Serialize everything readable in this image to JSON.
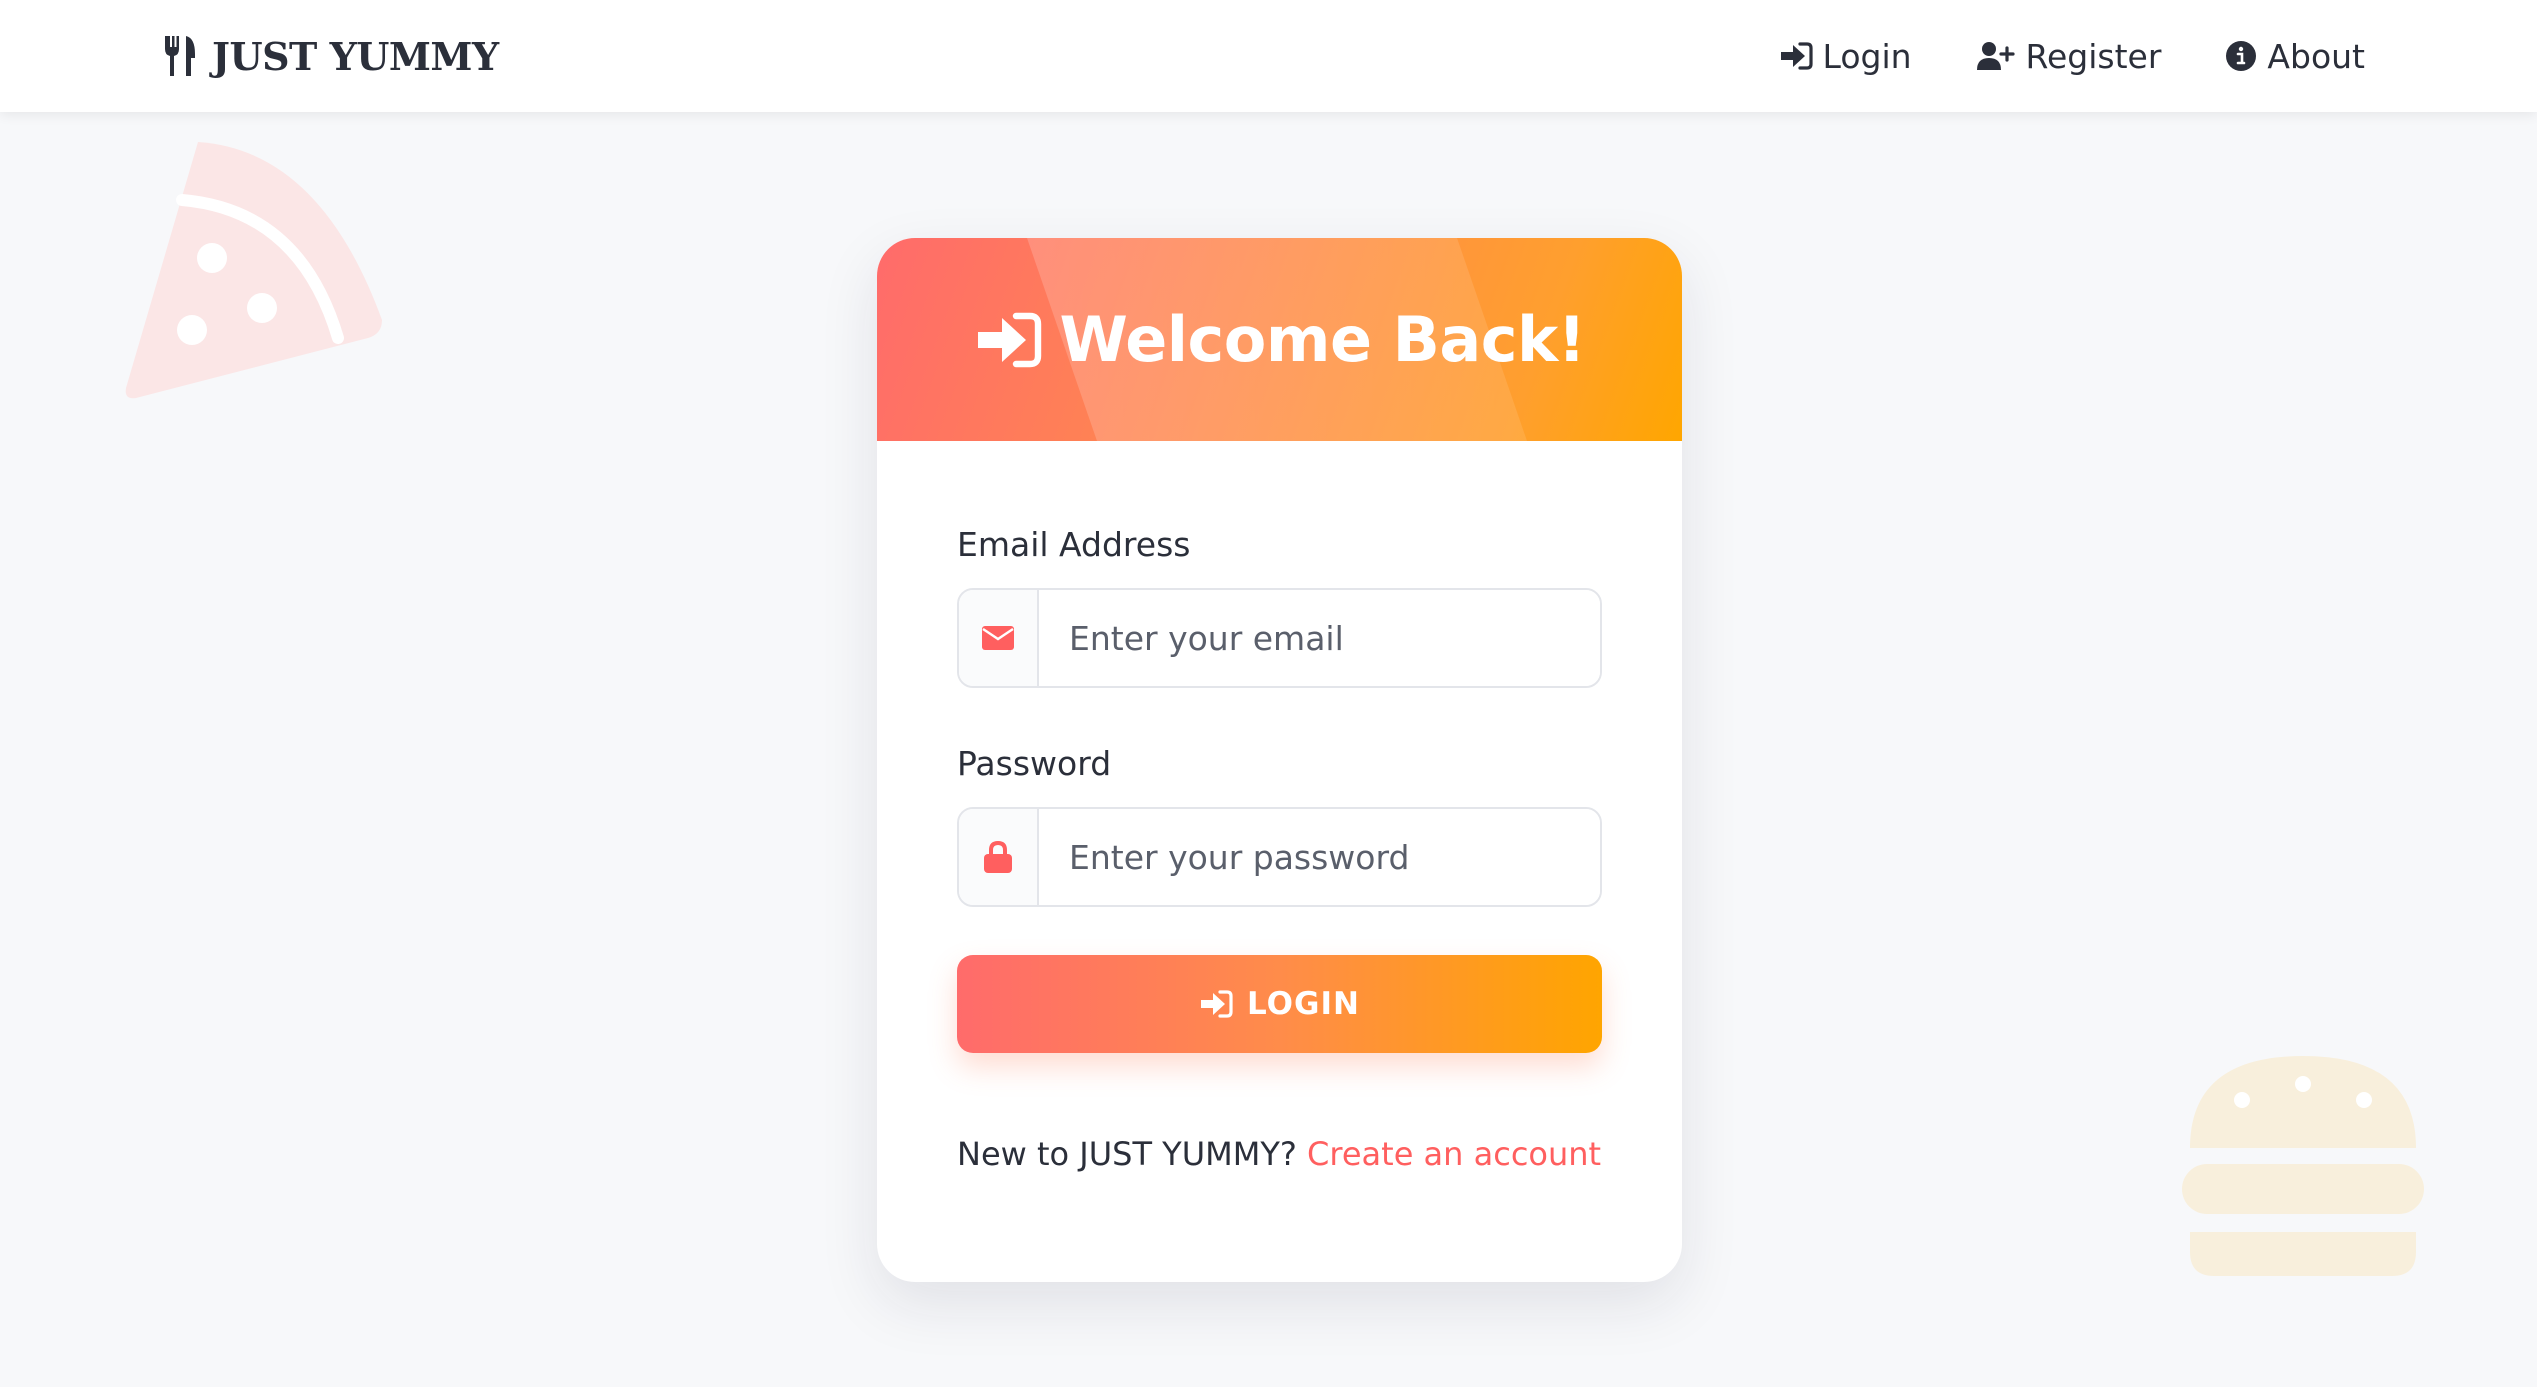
{
  "navbar": {
    "brand": "JUST YUMMY",
    "links": [
      {
        "label": "Login",
        "icon": "sign-in-icon"
      },
      {
        "label": "Register",
        "icon": "user-plus-icon"
      },
      {
        "label": "About",
        "icon": "info-circle-icon"
      }
    ]
  },
  "login_card": {
    "title": "Welcome Back!",
    "email": {
      "label": "Email Address",
      "placeholder": "Enter your email",
      "icon": "envelope-icon"
    },
    "password": {
      "label": "Password",
      "placeholder": "Enter your password",
      "icon": "lock-icon"
    },
    "submit_label": "LOGIN",
    "register_prompt": "New to JUST YUMMY?",
    "register_link": "Create an account"
  },
  "colors": {
    "accent_start": "#ff6b6b",
    "accent_end": "#ffa500",
    "link": "#ff5f5f",
    "text": "#2b2f3a",
    "background": "#f7f8fa"
  },
  "decorations": [
    "pizza-slice-icon",
    "burger-icon"
  ]
}
